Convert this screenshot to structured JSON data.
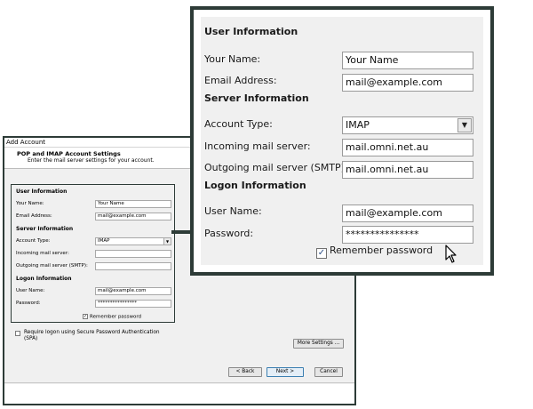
{
  "dialog": {
    "title": "Add Account",
    "header_title": "POP and IMAP Account Settings",
    "header_subtitle": "Enter the mail server settings for your account.",
    "user_info": {
      "heading": "User Information",
      "your_name_label": "Your Name:",
      "your_name_value": "Your Name",
      "email_label": "Email Address:",
      "email_value": "mail@example.com"
    },
    "server_info": {
      "heading": "Server Information",
      "account_type_label": "Account Type:",
      "account_type_value": "IMAP",
      "incoming_label": "Incoming mail server:",
      "incoming_value": "",
      "outgoing_label": "Outgoing mail server (SMTP):",
      "outgoing_value": ""
    },
    "logon_info": {
      "heading": "Logon Information",
      "username_label": "User Name:",
      "username_value": "mail@example.com",
      "password_label": "Password:",
      "password_value": "****************",
      "remember_label": "Remember password",
      "remember_checked": true
    },
    "spa_label_line1": "Require logon using Secure Password Authentication",
    "spa_label_line2": "(SPA)",
    "more_settings_label": "More Settings ...",
    "back_label": "< Back",
    "next_label": "Next >",
    "cancel_label": "Cancel"
  },
  "zoom": {
    "user_info_heading": "User Information",
    "your_name_label": "Your Name:",
    "your_name_value": "Your Name",
    "email_label": "Email Address:",
    "email_value": "mail@example.com",
    "server_info_heading": "Server Information",
    "account_type_label": "Account Type:",
    "account_type_value": "IMAP",
    "incoming_label": "Incoming mail server:",
    "incoming_value": "mail.omni.net.au",
    "outgoing_label": "Outgoing mail server (SMTP):",
    "outgoing_value": "mail.omni.net.au",
    "logon_info_heading": "Logon Information",
    "username_label": "User Name:",
    "username_value": "mail@example.com",
    "password_label": "Password:",
    "password_value": "***************",
    "remember_label": "Remember password",
    "remember_checked": true
  },
  "icons": {
    "checkmark": "checkmark-icon",
    "dropdown": "chevron-down-icon",
    "cursor": "mouse-pointer-icon"
  },
  "colors": {
    "frame": "#2d3b37",
    "panel_bg": "#f0f0f0"
  }
}
